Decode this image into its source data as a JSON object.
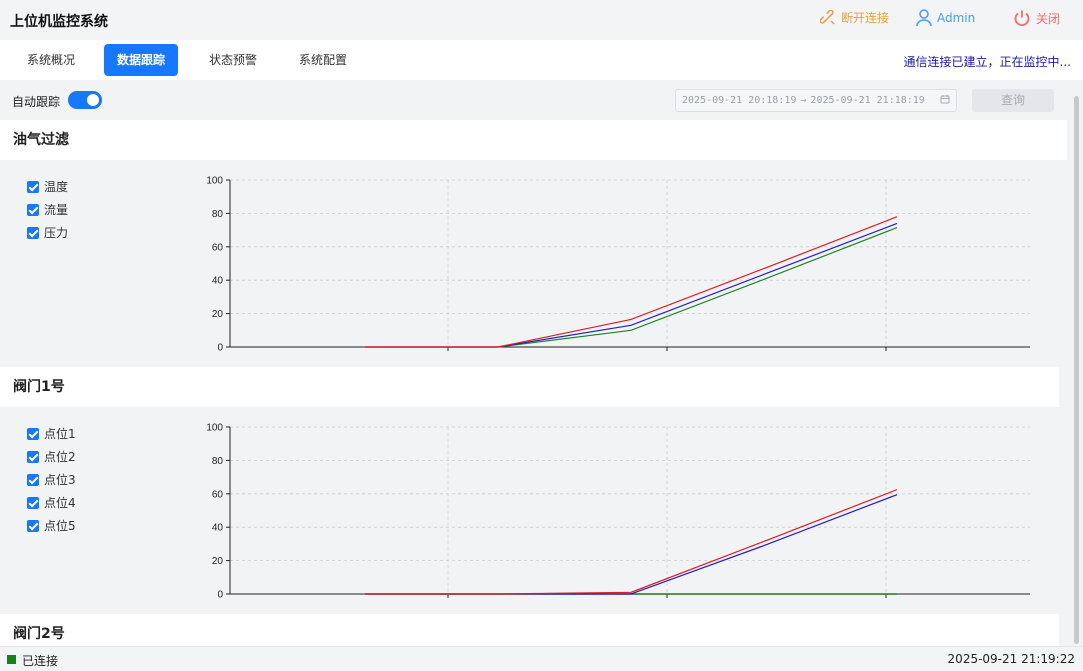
{
  "app": {
    "title": "上位机监控系统"
  },
  "titlebar": {
    "disconnect_label": "断开连接",
    "user_label": "Admin",
    "close_label": "关闭",
    "colors": {
      "disconnect": "#e6a23c",
      "user": "#409eff",
      "close": "#f56c6c"
    }
  },
  "nav": {
    "tabs": [
      {
        "label": "系统概况",
        "active": false
      },
      {
        "label": "数据跟踪",
        "active": true
      },
      {
        "label": "状态预警",
        "active": false
      },
      {
        "label": "系统配置",
        "active": false
      }
    ],
    "connection_message": "通信连接已建立，正在监控中..."
  },
  "toolbar": {
    "auto_track_label": "自动跟踪",
    "auto_track_on": true,
    "range_start": "2025-09-21 20:18:19",
    "range_separator": "→",
    "range_end": "2025-09-21 21:18:19",
    "query_label": "查询"
  },
  "sections": [
    {
      "title": "油气过滤",
      "legend": [
        "温度",
        "流量",
        "压力"
      ]
    },
    {
      "title": "阀门1号",
      "legend": [
        "点位1",
        "点位2",
        "点位3",
        "点位4",
        "点位5"
      ]
    },
    {
      "title": "阀门2号"
    }
  ],
  "chart_data": [
    {
      "type": "line",
      "title": "",
      "ylim": [
        0,
        100
      ],
      "yticks": [
        "0",
        "20",
        "40",
        "60",
        "80",
        "100"
      ],
      "grid": true,
      "x": [
        0,
        1,
        2,
        3,
        4
      ],
      "series": [
        {
          "name": "温度",
          "color": "#e31a1c",
          "values": [
            0,
            0,
            16.5,
            47,
            78
          ]
        },
        {
          "name": "流量",
          "color": "#1f1fcf",
          "values": [
            0,
            0,
            13,
            43.5,
            74
          ]
        },
        {
          "name": "压力",
          "color": "#1a8a1a",
          "values": [
            0,
            0,
            10,
            40.5,
            71.5
          ]
        }
      ]
    },
    {
      "type": "line",
      "title": "",
      "ylim": [
        0,
        100
      ],
      "yticks": [
        "0",
        "20",
        "40",
        "60",
        "80",
        "100"
      ],
      "grid": true,
      "x": [
        0,
        1,
        2,
        3,
        4
      ],
      "series": [
        {
          "name": "点位1",
          "color": "#e31a1c",
          "values": [
            0,
            0,
            1,
            31.5,
            62.5
          ]
        },
        {
          "name": "点位2",
          "color": "#1f1fcf",
          "values": [
            0,
            0,
            0,
            29,
            59.5
          ]
        },
        {
          "name": "点位3",
          "color": "#1a8a1a",
          "values": [
            0,
            0,
            0,
            0,
            0
          ]
        },
        {
          "name": "点位4",
          "color": "#b8860b",
          "values": [
            0,
            0,
            0,
            0,
            0
          ]
        },
        {
          "name": "点位5",
          "color": "#222222",
          "values": [
            0,
            0,
            0,
            0,
            0
          ]
        }
      ]
    }
  ],
  "statusbar": {
    "status_label": "已连接",
    "status_color": "#1a7f1a",
    "datetime": "2025-09-21 21:19:22"
  }
}
